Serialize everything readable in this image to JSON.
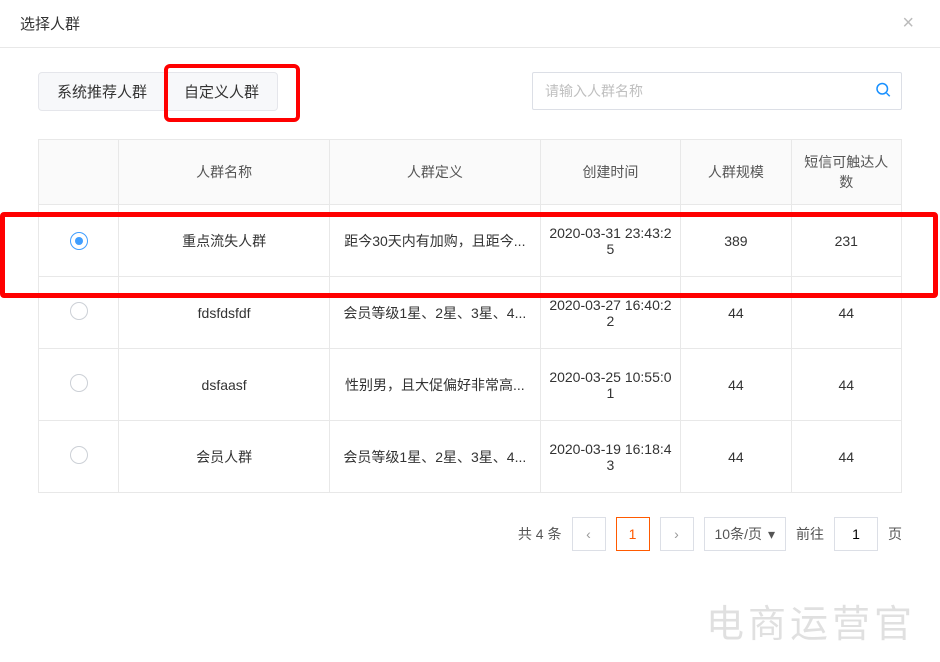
{
  "modal": {
    "title": "选择人群",
    "close_label": "×"
  },
  "tabs": {
    "system": "系统推荐人群",
    "custom": "自定义人群",
    "active_index": 1
  },
  "search": {
    "placeholder": "请输入人群名称"
  },
  "table": {
    "headers": {
      "name": "人群名称",
      "definition": "人群定义",
      "created_at": "创建时间",
      "scale": "人群规模",
      "reachable": "短信可触达人数"
    },
    "rows": [
      {
        "selected": true,
        "name": "重点流失人群",
        "definition": "距今30天内有加购，且距今...",
        "created_at": "2020-03-31 23:43:25",
        "scale": "389",
        "reachable": "231"
      },
      {
        "selected": false,
        "name": "fdsfdsfdf",
        "definition": "会员等级1星、2星、3星、4...",
        "created_at": "2020-03-27 16:40:22",
        "scale": "44",
        "reachable": "44"
      },
      {
        "selected": false,
        "name": "dsfaasf",
        "definition": "性别男，且大促偏好非常高...",
        "created_at": "2020-03-25 10:55:01",
        "scale": "44",
        "reachable": "44"
      },
      {
        "selected": false,
        "name": "会员人群",
        "definition": "会员等级1星、2星、3星、4...",
        "created_at": "2020-03-19 16:18:43",
        "scale": "44",
        "reachable": "44"
      }
    ]
  },
  "pagination": {
    "total_label": "共 4 条",
    "prev": "‹",
    "current": "1",
    "next": "›",
    "page_size_label": "10条/页",
    "jump_prefix": "前往",
    "jump_value": "1",
    "jump_suffix": "页"
  },
  "watermark": "电商运营官"
}
